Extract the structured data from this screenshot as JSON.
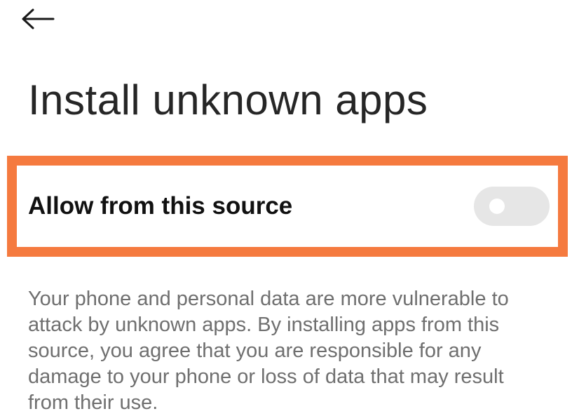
{
  "header": {
    "back_icon": "arrow-left-icon",
    "title": "Install unknown apps"
  },
  "setting": {
    "label": "Allow from this source",
    "toggle_on": false,
    "toggle_track_color": "#e6e6e6",
    "highlight_color": "#f57a3f"
  },
  "description": {
    "text": "Your phone and personal data are more vulnerable to attack by unknown apps. By installing apps from this source, you agree that you are responsible for any damage to your phone or loss of data that may result from their use."
  }
}
